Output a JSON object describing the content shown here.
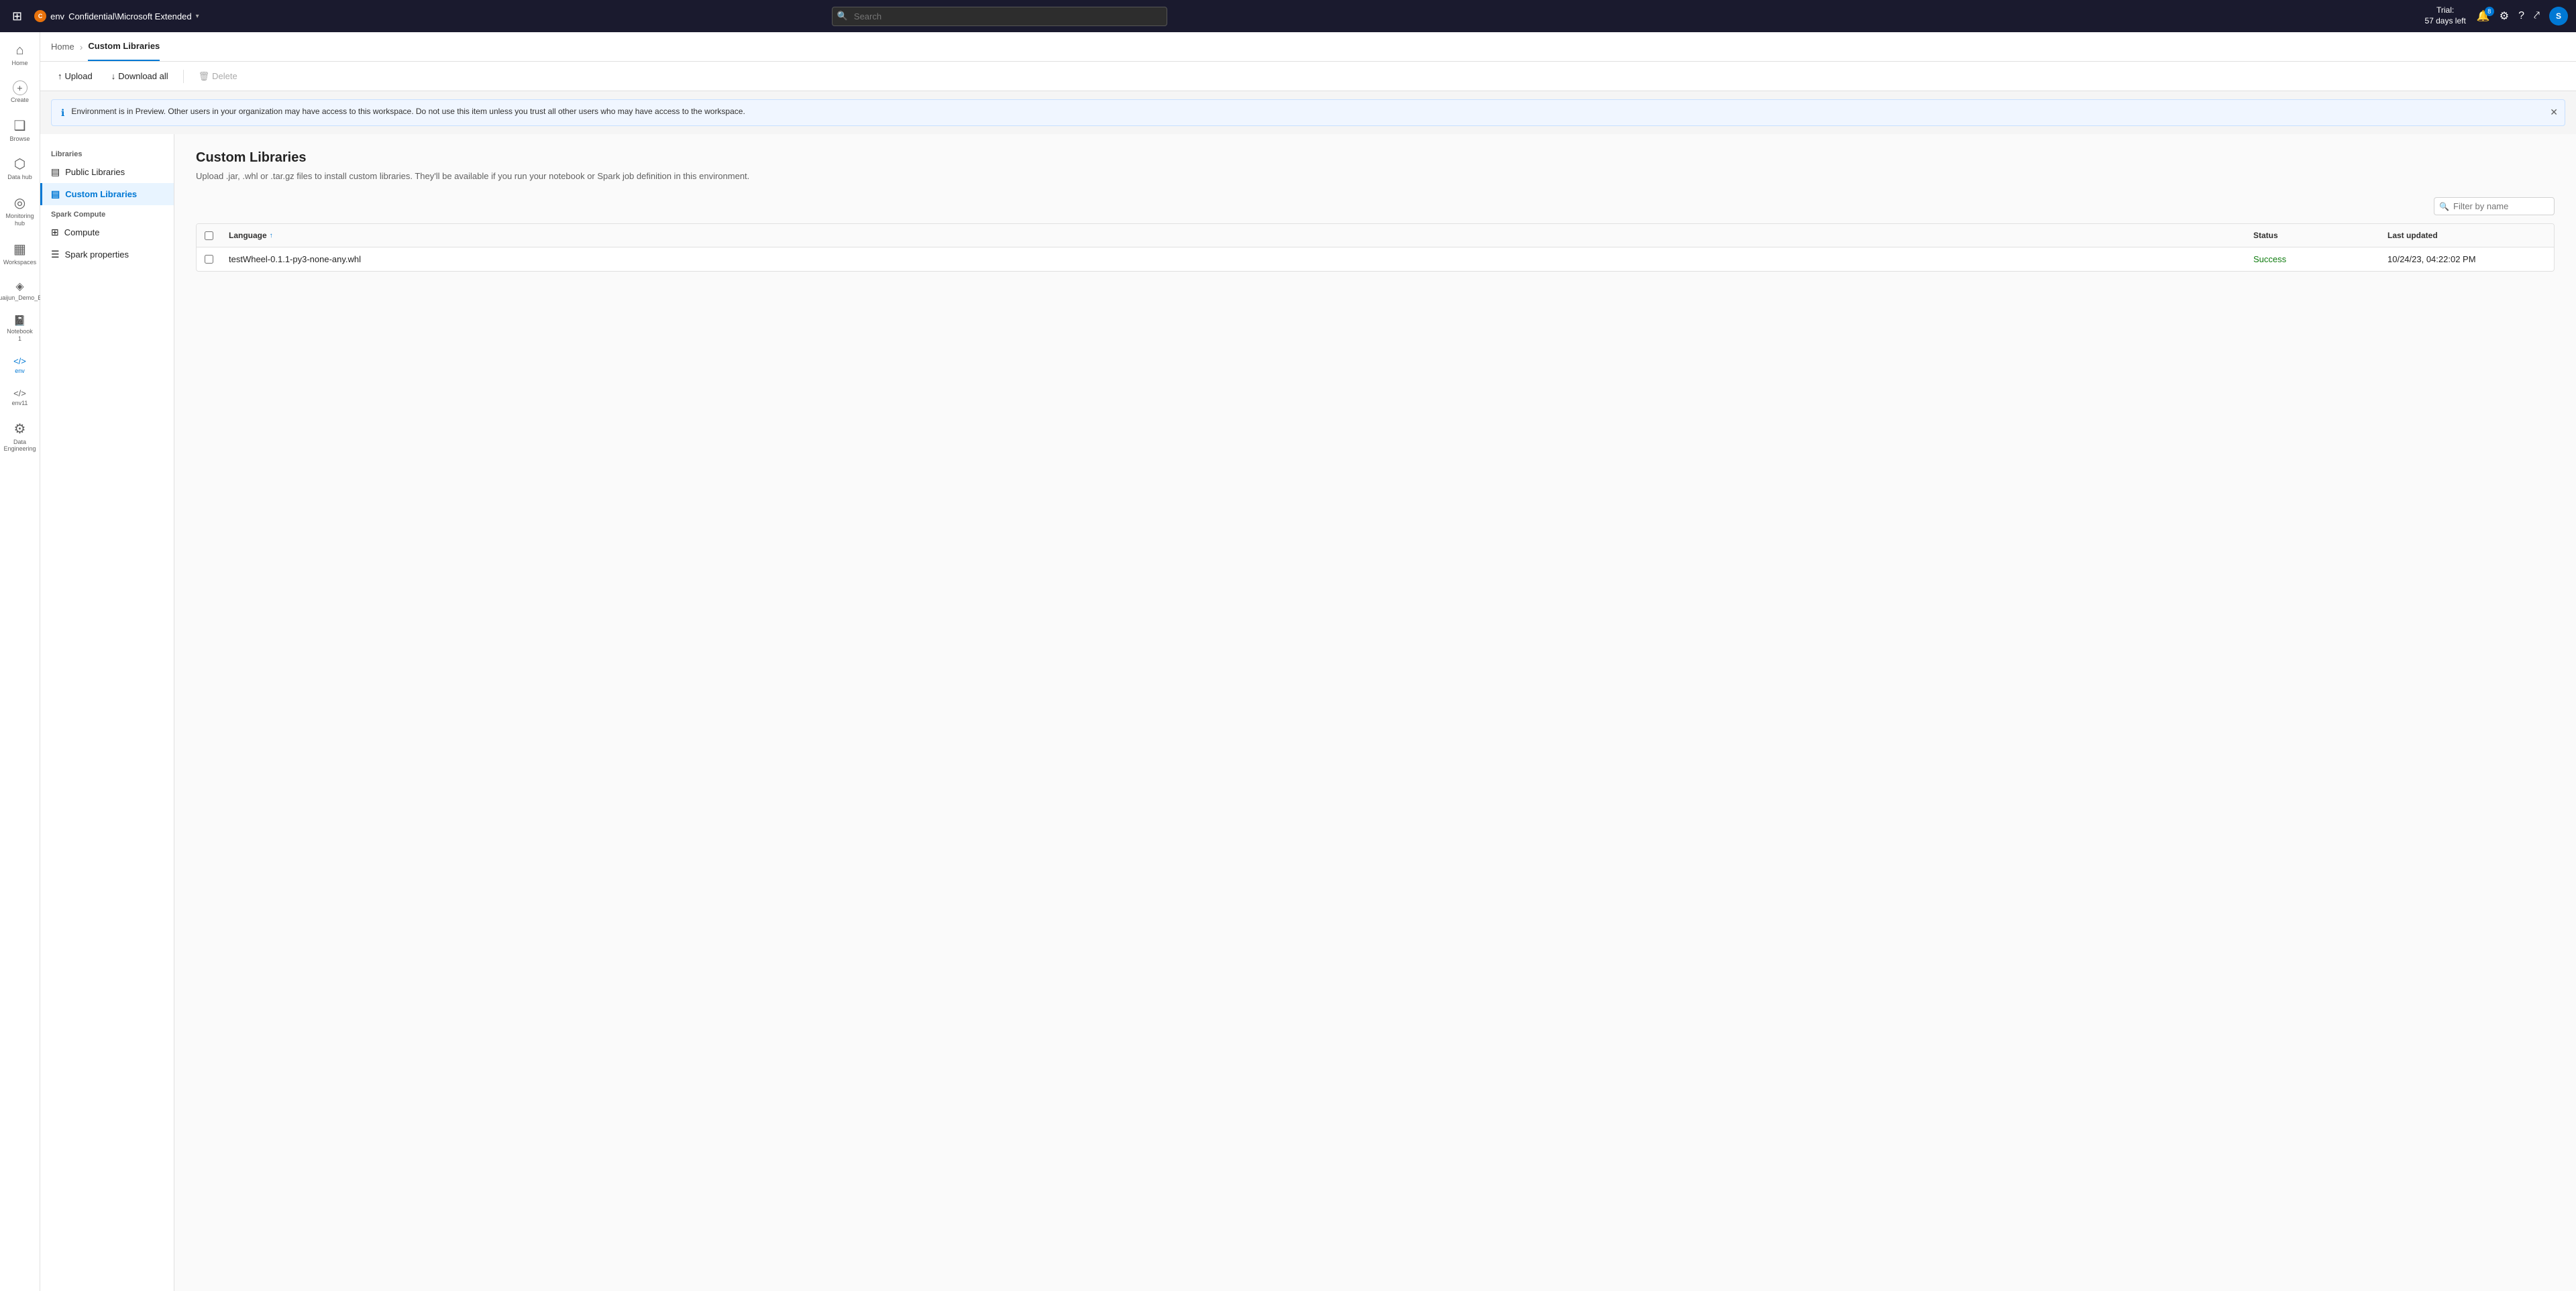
{
  "topbar": {
    "waffle_icon": "⊞",
    "env_label": "env",
    "env_icon_text": "C",
    "product_name": "Confidential\\Microsoft Extended",
    "chevron": "▾",
    "search_placeholder": "Search",
    "trial_label": "Trial:",
    "trial_days": "57 days left",
    "notification_count": "8",
    "settings_icon": "⚙",
    "help_icon": "?",
    "share_icon": "⤤",
    "avatar_text": "S"
  },
  "left_nav": {
    "items": [
      {
        "id": "home",
        "icon": "⌂",
        "label": "Home"
      },
      {
        "id": "create",
        "icon": "+",
        "label": "Create"
      },
      {
        "id": "browse",
        "icon": "❑",
        "label": "Browse"
      },
      {
        "id": "datahub",
        "icon": "⬡",
        "label": "Data hub"
      },
      {
        "id": "monitoring",
        "icon": "◎",
        "label": "Monitoring hub"
      },
      {
        "id": "workspaces",
        "icon": "▦",
        "label": "Workspaces"
      },
      {
        "id": "shuaijun",
        "icon": "◈",
        "label": "Shuaijun_Demo_Env"
      },
      {
        "id": "notebook1",
        "icon": "📓",
        "label": "Notebook 1"
      },
      {
        "id": "env",
        "icon": "</>",
        "label": "env",
        "active": true
      },
      {
        "id": "env11",
        "icon": "</>",
        "label": "env11"
      },
      {
        "id": "dataeng",
        "icon": "⚙",
        "label": "Data Engineering"
      }
    ]
  },
  "breadcrumb": {
    "items": [
      {
        "id": "home",
        "label": "Home",
        "active": false
      },
      {
        "id": "custom-libraries",
        "label": "Custom Libraries",
        "active": true
      }
    ]
  },
  "toolbar": {
    "upload_label": "Upload",
    "download_all_label": "Download all",
    "delete_label": "Delete"
  },
  "banner": {
    "message": "Environment is in Preview. Other users in your organization may have access to this workspace. Do not use this item unless you trust all other users who may have access to the workspace."
  },
  "sidebar": {
    "libraries_section": "Libraries",
    "spark_compute_section": "Spark Compute",
    "items": [
      {
        "id": "public-libraries",
        "icon": "▤",
        "label": "Public Libraries",
        "active": false
      },
      {
        "id": "custom-libraries",
        "icon": "▤",
        "label": "Custom Libraries",
        "active": true
      },
      {
        "id": "compute",
        "icon": "⊞",
        "label": "Compute",
        "active": false
      },
      {
        "id": "spark-properties",
        "icon": "☰",
        "label": "Spark properties",
        "active": false
      }
    ]
  },
  "main_panel": {
    "title": "Custom Libraries",
    "subtitle": "Upload .jar, .whl or .tar.gz files to install custom libraries. They'll be available if you run your notebook or Spark job definition in this environment.",
    "filter_placeholder": "Filter by name",
    "table": {
      "columns": [
        {
          "id": "checkbox",
          "label": ""
        },
        {
          "id": "language",
          "label": "Language",
          "sortable": true
        },
        {
          "id": "status",
          "label": "Status"
        },
        {
          "id": "last_updated",
          "label": "Last updated"
        }
      ],
      "rows": [
        {
          "id": "row-1",
          "name": "testWheel-0.1.1-py3-none-any.whl",
          "status": "Success",
          "last_updated": "10/24/23, 04:22:02 PM"
        }
      ]
    }
  }
}
